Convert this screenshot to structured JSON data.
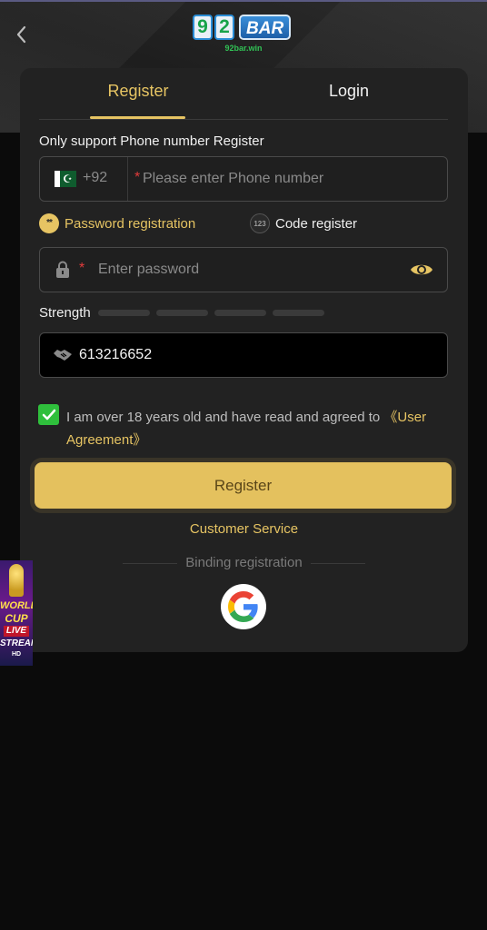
{
  "header": {
    "back_icon": "chevron-left-icon",
    "logo": {
      "digits": [
        "9",
        "2"
      ],
      "word": "BAR",
      "domain": "92bar.win"
    }
  },
  "tabs": [
    {
      "label": "Register",
      "active": true
    },
    {
      "label": "Login",
      "active": false
    }
  ],
  "form": {
    "hint": "Only support Phone number Register",
    "phone": {
      "country_code": "+92",
      "flag_icon": "pakistan-flag-icon",
      "required_mark": "*",
      "placeholder": "Please enter Phone number",
      "value": ""
    },
    "registration_options": [
      {
        "label": "Password registration",
        "icon": "password-dots-icon",
        "icon_text": "**",
        "selected": true
      },
      {
        "label": "Code register",
        "icon": "code-123-icon",
        "icon_text": "123",
        "selected": false
      }
    ],
    "password": {
      "required_mark": "*",
      "placeholder": "Enter password",
      "value": "",
      "lock_icon": "lock-icon",
      "visibility_icon": "eye-icon"
    },
    "strength": {
      "label": "Strength",
      "segments": 4,
      "filled": 0
    },
    "invite": {
      "icon": "handshake-icon",
      "value": "613216652"
    },
    "agreement": {
      "checked": true,
      "text": "I am over 18 years old and have read and agreed to ",
      "link": "《User Agreement》"
    },
    "submit_label": "Register"
  },
  "customer_service": "Customer Service",
  "binding": {
    "label": "Binding registration",
    "google_icon": "google-icon"
  },
  "banner": {
    "lines": [
      "WORLD",
      "CUP",
      "LIVE",
      "STREAM",
      "HD"
    ]
  },
  "colors": {
    "accent": "#e6c463",
    "button": "#e4c15e",
    "checkbox": "#2fbf3c",
    "required": "#e23b3b",
    "card": "#222222",
    "background": "#0b0b0b"
  }
}
